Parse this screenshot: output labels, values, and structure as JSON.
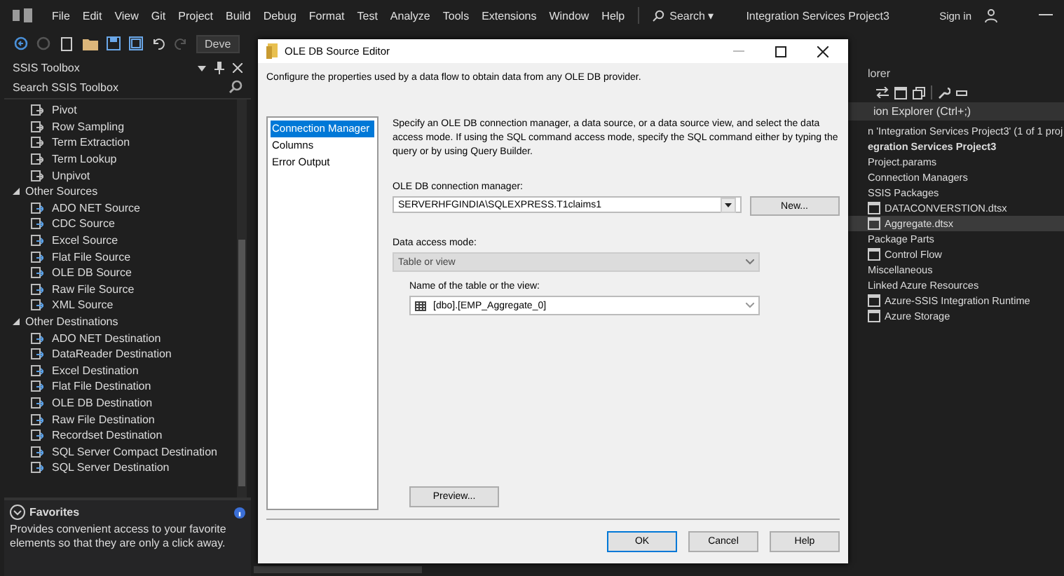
{
  "menubar": {
    "items": [
      "File",
      "Edit",
      "View",
      "Git",
      "Project",
      "Build",
      "Debug",
      "Format",
      "Test",
      "Analyze",
      "Tools",
      "Extensions",
      "Window",
      "Help"
    ],
    "search": "Search ▾",
    "title": "Integration Services Project3",
    "sign_in": "Sign in"
  },
  "toolbar": {
    "config_dropdown": "Deve"
  },
  "toolbox": {
    "title": "SSIS Toolbox",
    "search_placeholder": "Search SSIS Toolbox",
    "groups": [
      {
        "items": [
          "Pivot",
          "Row Sampling",
          "Term Extraction",
          "Term Lookup",
          "Unpivot"
        ]
      },
      {
        "label": "Other Sources",
        "expanded": true,
        "items": [
          "ADO NET Source",
          "CDC Source",
          "Excel Source",
          "Flat File Source",
          "OLE DB Source",
          "Raw File Source",
          "XML Source"
        ]
      },
      {
        "label": "Other Destinations",
        "expanded": true,
        "items": [
          "ADO NET Destination",
          "DataReader Destination",
          "Excel Destination",
          "Flat File Destination",
          "OLE DB Destination",
          "Raw File Destination",
          "Recordset Destination",
          "SQL Server Compact Destination",
          "SQL Server Destination"
        ]
      }
    ],
    "favorites": {
      "title": "Favorites",
      "description": "Provides convenient access to your favorite elements so that they are only a click away."
    }
  },
  "solution_explorer": {
    "title": "lorer",
    "search_placeholder": "ion Explorer (Ctrl+;)",
    "tree": [
      {
        "label": "n 'Integration Services Project3' (1 of 1 proj",
        "selected": false,
        "children": [
          {
            "label": "egration Services Project3",
            "selected": false,
            "children": [
              {
                "label": "Project.params",
                "selected": false
              },
              {
                "label": "Connection Managers",
                "selected": false
              },
              {
                "label": "SSIS Packages",
                "selected": false,
                "children": [
                  {
                    "label": "DATACONVERSTION.dtsx",
                    "selected": false
                  },
                  {
                    "label": "Aggregate.dtsx",
                    "selected": true
                  }
                ]
              },
              {
                "label": "Package Parts",
                "selected": false,
                "children": [
                  {
                    "label": "Control Flow",
                    "selected": false
                  }
                ]
              },
              {
                "label": "Miscellaneous",
                "selected": false
              },
              {
                "label": "Linked Azure Resources",
                "selected": false,
                "children": [
                  {
                    "label": "Azure-SSIS Integration Runtime",
                    "selected": false
                  },
                  {
                    "label": "Azure Storage",
                    "selected": false
                  }
                ]
              }
            ]
          }
        ]
      }
    ]
  },
  "dialog": {
    "title": "OLE DB Source Editor",
    "description": "Configure the properties used by a data flow to obtain data from any OLE DB provider.",
    "nav": [
      {
        "label": "Connection Manager",
        "selected": true
      },
      {
        "label": "Columns",
        "selected": false
      },
      {
        "label": "Error Output",
        "selected": false
      }
    ],
    "instructions": "Specify an OLE DB connection manager, a data source, or a data source view, and select the data access mode. If using the SQL command access mode, specify the SQL command either by typing the query or by using Query Builder.",
    "connection_label": "OLE DB connection manager:",
    "connection_value": "SERVERHFGINDIA\\SQLEXPRESS.T1claims1",
    "new_button": "New...",
    "access_label": "Data access mode:",
    "access_value": "Table or view",
    "access_disabled": true,
    "table_label": "Name of the table or the view:",
    "table_value": "[dbo].[EMP_Aggregate_0]",
    "preview_button": "Preview...",
    "buttons": [
      "OK",
      "Cancel",
      "Help"
    ]
  }
}
